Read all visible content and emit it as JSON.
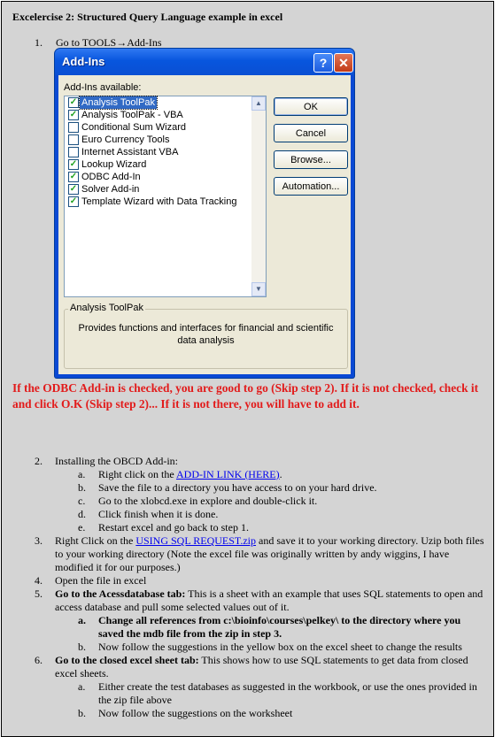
{
  "doc": {
    "title": "Excelercise 2: Structured Query Language example in excel",
    "step1_num": "1.",
    "step1_text": "Go to TOOLS→Add-Ins",
    "red_note": "If the ODBC Add-in is checked, you are good to go (Skip step 2). If it is not checked, check it and click O.K (Skip step 2)...  If it is not there, you will have to add it."
  },
  "dialog": {
    "title": "Add-Ins",
    "help_glyph": "?",
    "close_glyph": "✕",
    "available_label": "Add-Ins available:",
    "items": [
      {
        "label": "Analysis ToolPak",
        "checked": true,
        "selected": true
      },
      {
        "label": "Analysis ToolPak - VBA",
        "checked": true,
        "selected": false
      },
      {
        "label": "Conditional Sum Wizard",
        "checked": false,
        "selected": false
      },
      {
        "label": "Euro Currency Tools",
        "checked": false,
        "selected": false
      },
      {
        "label": "Internet Assistant VBA",
        "checked": false,
        "selected": false
      },
      {
        "label": "Lookup Wizard",
        "checked": true,
        "selected": false
      },
      {
        "label": "ODBC Add-In",
        "checked": true,
        "selected": false
      },
      {
        "label": "Solver Add-in",
        "checked": true,
        "selected": false
      },
      {
        "label": "Template Wizard with Data Tracking",
        "checked": true,
        "selected": false
      }
    ],
    "buttons": {
      "ok": "OK",
      "cancel": "Cancel",
      "browse": "Browse...",
      "automation": "Automation..."
    },
    "group_title": "Analysis ToolPak",
    "group_desc": "Provides functions and interfaces for financial and scientific data analysis"
  },
  "steps": {
    "s2": {
      "num": "2.",
      "text": "Installing the OBCD Add-in:"
    },
    "s2a": {
      "num": "a.",
      "pre": "Right click on the ",
      "link": "ADD-IN LINK (HERE)",
      "post": "."
    },
    "s2b": {
      "num": "b.",
      "text": "Save the file to a directory you have access to on your hard drive."
    },
    "s2c": {
      "num": "c.",
      "text": "Go to the xlobcd.exe in explore and double-click it."
    },
    "s2d": {
      "num": "d.",
      "text": "Click finish when it is done."
    },
    "s2e": {
      "num": "e.",
      "text": "Restart excel and go back to step 1."
    },
    "s3": {
      "num": "3.",
      "pre": "Right Click on the ",
      "link": "USING SQL REQUEST.zip",
      "post": " and save it to your working directory. Uzip both files to your working directory (Note the excel file was originally written by andy wiggins, I have modified it for our purposes.)"
    },
    "s4": {
      "num": "4.",
      "text": "Open the file in excel"
    },
    "s5": {
      "num": "5.",
      "bold": "Go to the Acessdatabase tab:",
      "text": "  This is a sheet with an example that uses SQL statements to open and access database and pull some selected values out of it."
    },
    "s5a": {
      "num": "a.",
      "text": "Change all references from c:\\bioinfo\\courses\\pelkey\\  to  the directory where you saved the mdb file from the zip in step 3."
    },
    "s5b": {
      "num": "b.",
      "text": "Now follow the suggestions in the yellow box on the excel sheet to change the results"
    },
    "s6": {
      "num": "6.",
      "bold": "Go to the closed excel sheet tab:",
      "text": " This shows how to use SQL statements to get data from closed excel sheets."
    },
    "s6a": {
      "num": "a.",
      "text": "Either create the test databases as suggested in the workbook, or use the ones provided in the zip file above"
    },
    "s6b": {
      "num": "b.",
      "text": "Now follow the suggestions on the worksheet"
    }
  }
}
